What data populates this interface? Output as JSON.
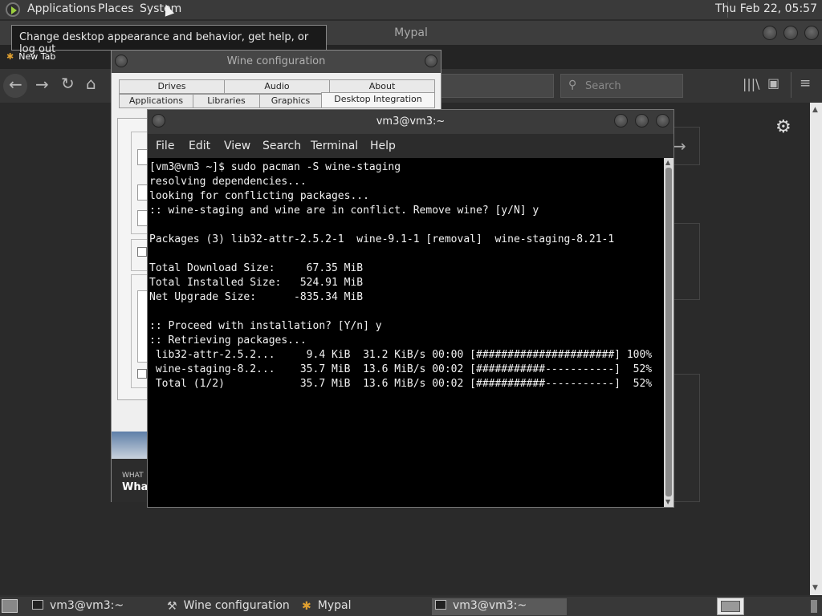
{
  "top_panel": {
    "menus": [
      "Applications",
      "Places",
      "System"
    ],
    "clock": "Thu Feb 22, 05:57"
  },
  "tooltip": "Change desktop appearance and behavior, get help, or log out",
  "browser": {
    "title": "Mypal",
    "tab_label": "New Tab",
    "search_placeholder": "Search",
    "content_snippet_small": "WHAT",
    "content_snippet_large": "What"
  },
  "wine": {
    "title": "Wine configuration",
    "tabs_row1": [
      "Drives",
      "Audio",
      "About"
    ],
    "tabs_row2": [
      "Applications",
      "Libraries",
      "Graphics",
      "Desktop Integration"
    ],
    "active_tab": "Desktop Integration"
  },
  "terminal": {
    "title": "vm3@vm3:~",
    "menus": [
      "File",
      "Edit",
      "View",
      "Search",
      "Terminal",
      "Help"
    ],
    "lines": [
      "[vm3@vm3 ~]$ sudo pacman -S wine-staging",
      "resolving dependencies...",
      "looking for conflicting packages...",
      ":: wine-staging and wine are in conflict. Remove wine? [y/N] y",
      "",
      "Packages (3) lib32-attr-2.5.2-1  wine-9.1-1 [removal]  wine-staging-8.21-1",
      "",
      "Total Download Size:     67.35 MiB",
      "Total Installed Size:   524.91 MiB",
      "Net Upgrade Size:      -835.34 MiB",
      "",
      ":: Proceed with installation? [Y/n] y",
      ":: Retrieving packages...",
      " lib32-attr-2.5.2...     9.4 KiB  31.2 KiB/s 00:00 [######################] 100%",
      " wine-staging-8.2...    35.7 MiB  13.6 MiB/s 00:02 [###########-----------]  52%",
      " Total (1/2)            35.7 MiB  13.6 MiB/s 00:02 [###########-----------]  52%"
    ]
  },
  "taskbar": {
    "items": [
      "vm3@vm3:~",
      "Wine configuration",
      "Mypal",
      "vm3@vm3:~"
    ],
    "active_index": 3
  }
}
